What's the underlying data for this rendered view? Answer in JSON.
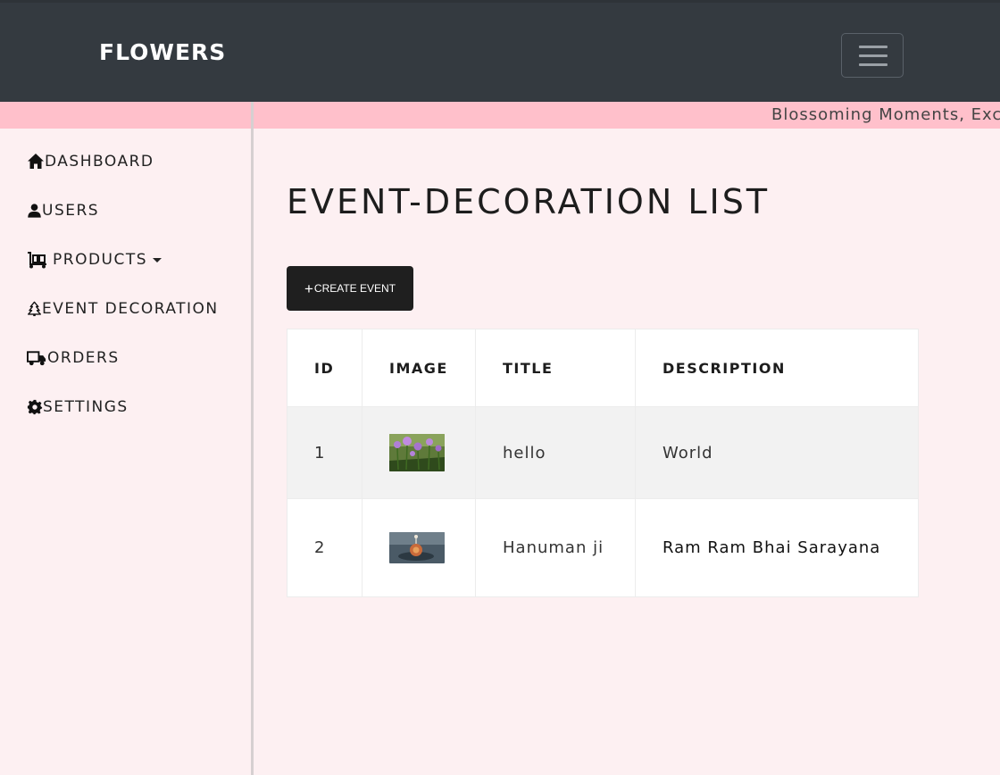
{
  "navbar": {
    "brand": "FLOWERS",
    "toggler_icon": "hamburger-icon"
  },
  "marquee": {
    "text": "Blossoming Moments, Exc"
  },
  "sidebar": {
    "items": [
      {
        "label": "DASHBOARD",
        "icon": "home-icon"
      },
      {
        "label": "USERS",
        "icon": "user-icon"
      },
      {
        "label": "PRODUCTS",
        "icon": "dolly-icon"
      },
      {
        "label": "EVENT DECORATION",
        "icon": "tree-icon"
      },
      {
        "label": "ORDERS",
        "icon": "truck-icon"
      },
      {
        "label": "SETTINGS",
        "icon": "gear-icon"
      }
    ]
  },
  "main": {
    "title": "EVENT-DECORATION LIST",
    "create_button": {
      "label": "CREATE EVENT",
      "icon": "plus-icon"
    },
    "table": {
      "headers": [
        "ID",
        "IMAGE",
        "TITLE",
        "DESCRIPTION"
      ],
      "rows": [
        {
          "id": "1",
          "image": "flowers-thumbnail",
          "title": "hello",
          "description": "World"
        },
        {
          "id": "2",
          "image": "decoration-thumbnail",
          "title": "Hanuman ji",
          "description": "Ram Ram Bhai Sarayana"
        }
      ]
    }
  },
  "colors": {
    "navbar": "#343a40",
    "strip": "#ffc0cb",
    "background": "#fdf0f2",
    "button": "#1f1f1f"
  }
}
